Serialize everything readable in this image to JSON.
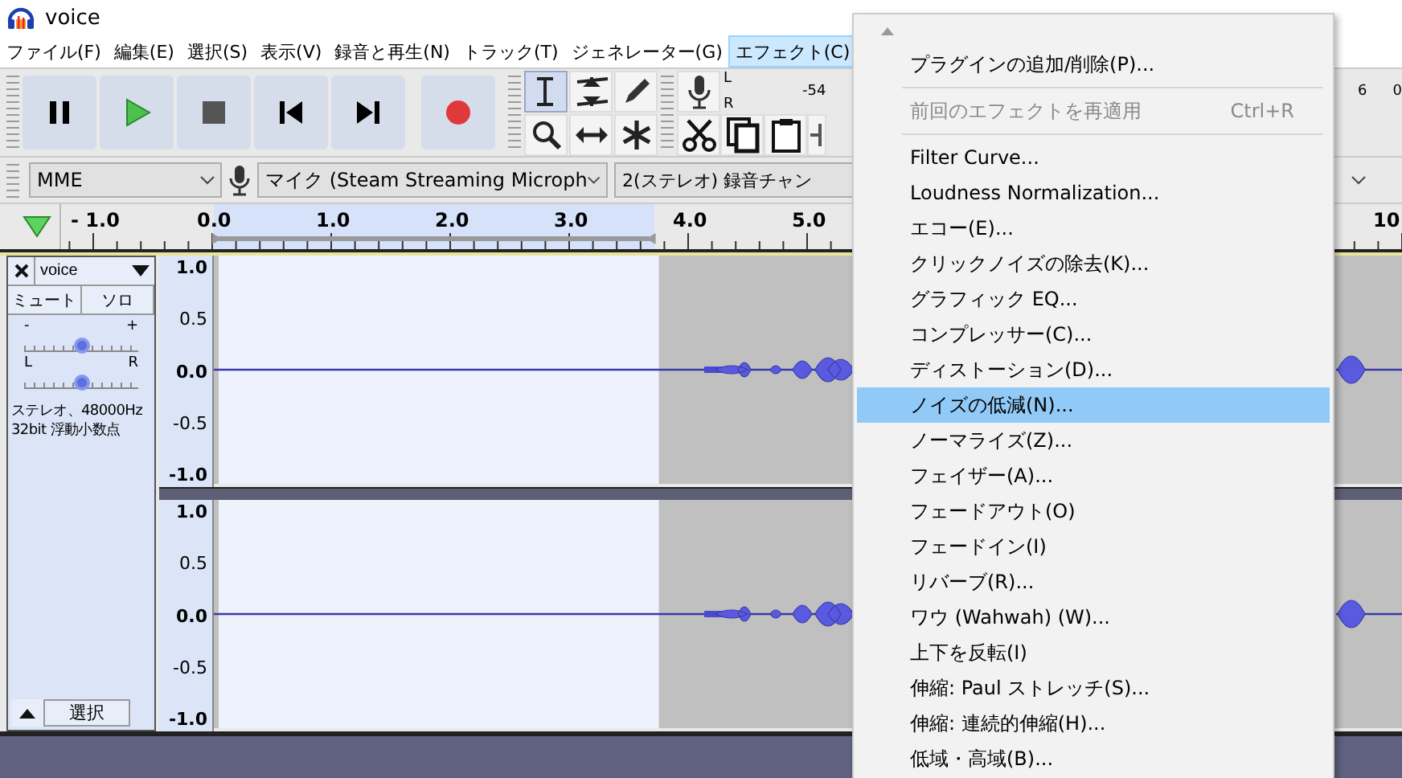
{
  "window": {
    "title": "voice"
  },
  "menu_bar": [
    {
      "label": "ファイル(F)",
      "selected": false
    },
    {
      "label": "編集(E)",
      "selected": false
    },
    {
      "label": "選択(S)",
      "selected": false
    },
    {
      "label": "表示(V)",
      "selected": false
    },
    {
      "label": "録音と再生(N)",
      "selected": false
    },
    {
      "label": "トラック(T)",
      "selected": false
    },
    {
      "label": "ジェネレーター(G)",
      "selected": false
    },
    {
      "label": "エフェクト(C)",
      "selected": true
    }
  ],
  "transport": [
    {
      "kind": "pause"
    },
    {
      "kind": "play"
    },
    {
      "kind": "stop"
    },
    {
      "kind": "skip_start"
    },
    {
      "kind": "skip_end"
    },
    {
      "kind": "record"
    }
  ],
  "tools": [
    {
      "kind": "select",
      "selected": true
    },
    {
      "kind": "envelope",
      "selected": false
    },
    {
      "kind": "draw",
      "selected": false
    },
    {
      "kind": "zoom",
      "selected": false
    },
    {
      "kind": "time_shift",
      "selected": false
    },
    {
      "kind": "multi",
      "selected": false
    }
  ],
  "edit_tools": [
    {
      "kind": "cut"
    },
    {
      "kind": "copy"
    },
    {
      "kind": "paste"
    },
    {
      "kind": "trim"
    }
  ],
  "meter": {
    "channels": [
      "L",
      "R"
    ],
    "scale": [
      "-54",
      "6",
      "0"
    ]
  },
  "device_bar": {
    "host": "MME",
    "input": "マイク (Steam Streaming Microph",
    "channels": "2(ステレオ) 録音チャン"
  },
  "timeline": {
    "labels": [
      "- 1.0",
      "0.0",
      "1.0",
      "2.0",
      "3.0",
      "4.0",
      "5.0",
      "10"
    ]
  },
  "track": {
    "name": "voice",
    "mute": "ミュート",
    "solo": "ソロ",
    "gain": {
      "minus": "-",
      "plus": "+",
      "level": 0.5
    },
    "pan": {
      "left": "L",
      "right": "R",
      "level": 0.5
    },
    "info": [
      "ステレオ、48000Hz",
      "32bit 浮動小数点"
    ],
    "select_button": "選択",
    "channels": [
      {
        "scale": [
          "1.0",
          "0.5",
          "0.0",
          "-0.5",
          "-1.0"
        ]
      },
      {
        "scale": [
          "1.0",
          "0.5",
          "0.0",
          "-0.5",
          "-1.0"
        ]
      }
    ]
  },
  "effect_menu": {
    "items": [
      {
        "kind": "item",
        "label": "プラグインの追加/削除(P)...",
        "selected": false,
        "disabled": false
      },
      {
        "kind": "separator"
      },
      {
        "kind": "item",
        "label": "前回のエフェクトを再適用",
        "shortcut": "Ctrl+R",
        "selected": false,
        "disabled": true
      },
      {
        "kind": "separator"
      },
      {
        "kind": "item",
        "label": "Filter Curve...",
        "selected": false,
        "disabled": false
      },
      {
        "kind": "item",
        "label": "Loudness Normalization...",
        "selected": false,
        "disabled": false
      },
      {
        "kind": "item",
        "label": "エコー(E)...",
        "selected": false,
        "disabled": false
      },
      {
        "kind": "item",
        "label": "クリックノイズの除去(K)...",
        "selected": false,
        "disabled": false
      },
      {
        "kind": "item",
        "label": "グラフィック EQ...",
        "selected": false,
        "disabled": false
      },
      {
        "kind": "item",
        "label": "コンプレッサー(C)...",
        "selected": false,
        "disabled": false
      },
      {
        "kind": "item",
        "label": "ディストーション(D)...",
        "selected": false,
        "disabled": false
      },
      {
        "kind": "item",
        "label": "ノイズの低減(N)...",
        "selected": true,
        "disabled": false
      },
      {
        "kind": "item",
        "label": "ノーマライズ(Z)...",
        "selected": false,
        "disabled": false
      },
      {
        "kind": "item",
        "label": "フェイザー(A)...",
        "selected": false,
        "disabled": false
      },
      {
        "kind": "item",
        "label": "フェードアウト(O)",
        "selected": false,
        "disabled": false
      },
      {
        "kind": "item",
        "label": "フェードイン(I)",
        "selected": false,
        "disabled": false
      },
      {
        "kind": "item",
        "label": "リバーブ(R)...",
        "selected": false,
        "disabled": false
      },
      {
        "kind": "item",
        "label": "ワウ (Wahwah) (W)...",
        "selected": false,
        "disabled": false
      },
      {
        "kind": "item",
        "label": "上下を反転(I)",
        "selected": false,
        "disabled": false
      },
      {
        "kind": "item",
        "label": "伸縮: Paul ストレッチ(S)...",
        "selected": false,
        "disabled": false
      },
      {
        "kind": "item",
        "label": "伸縮: 連続的伸縮(H)...",
        "selected": false,
        "disabled": false
      },
      {
        "kind": "item",
        "label": "低域・高域(B)...",
        "selected": false,
        "disabled": false
      }
    ]
  }
}
